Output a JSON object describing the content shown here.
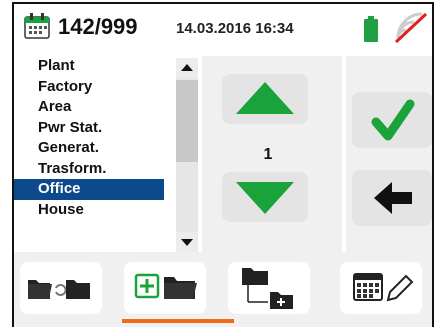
{
  "header": {
    "counter": "142/999",
    "datetime": "14.03.2016  16:34",
    "icons": [
      "memory-calendar-icon",
      "battery-icon",
      "no-signal-icon"
    ]
  },
  "list": {
    "items": [
      "Plant",
      "Factory",
      "Area",
      "Pwr Stat.",
      "Generat.",
      "Trasform.",
      "Office",
      "House"
    ],
    "selected": "Office"
  },
  "counter_value": "1",
  "controls": {
    "up_icon": "arrow-up-icon",
    "down_icon": "arrow-down-icon",
    "confirm_icon": "checkmark-icon",
    "back_icon": "arrow-left-icon"
  },
  "toolbar": {
    "buttons": [
      "folder-move-icon",
      "add-folder-icon",
      "subfolder-add-icon",
      "calendar-edit-icon"
    ],
    "active_index": 1
  },
  "colors": {
    "accent": "#f06a1a",
    "selection": "#0d4a8c",
    "green": "#1aa33a",
    "battery": "#20a040"
  }
}
